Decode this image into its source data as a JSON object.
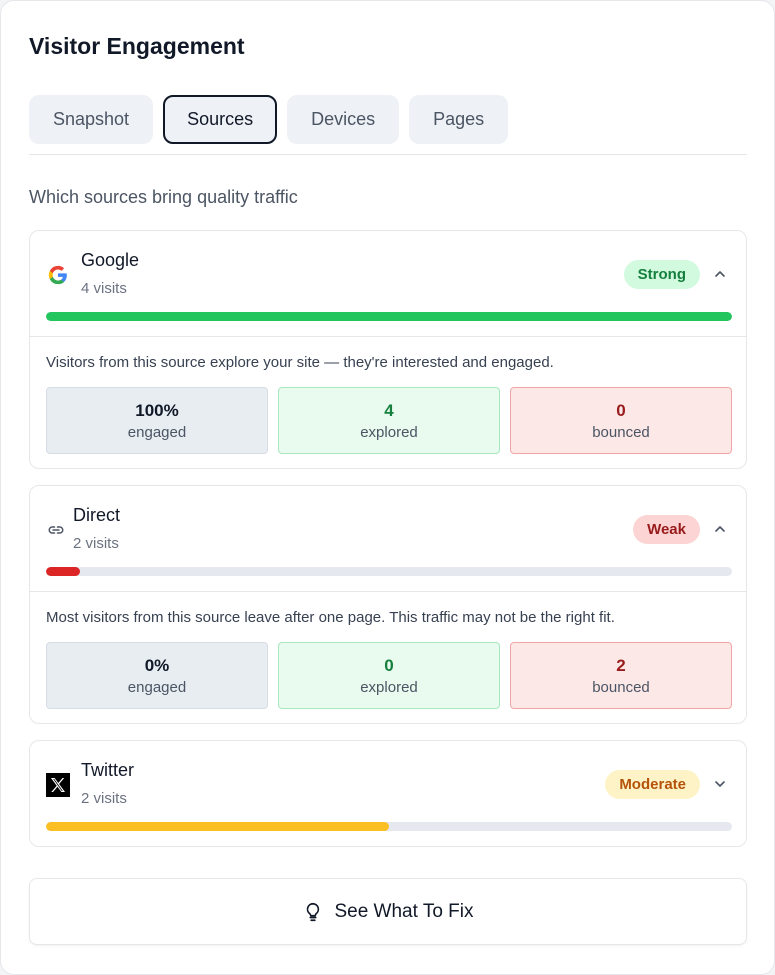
{
  "page": {
    "title": "Visitor Engagement",
    "subtitle": "Which sources bring quality traffic"
  },
  "tabs": [
    {
      "label": "Snapshot",
      "active": false
    },
    {
      "label": "Sources",
      "active": true
    },
    {
      "label": "Devices",
      "active": false
    },
    {
      "label": "Pages",
      "active": false
    }
  ],
  "sources": [
    {
      "name": "Google",
      "visits": "4 visits",
      "badge": "Strong",
      "icon": "google-icon",
      "bar_fraction": 1.0,
      "expanded": true,
      "description": "Visitors from this source explore your site — they're interested and engaged.",
      "stats": {
        "engaged": "100%",
        "engaged_label": "engaged",
        "explored": "4",
        "explored_label": "explored",
        "bounced": "0",
        "bounced_label": "bounced"
      }
    },
    {
      "name": "Direct",
      "visits": "2 visits",
      "badge": "Weak",
      "icon": "link-icon",
      "bar_fraction": 0.05,
      "expanded": true,
      "description": "Most visitors from this source leave after one page. This traffic may not be the right fit.",
      "stats": {
        "engaged": "0%",
        "engaged_label": "engaged",
        "explored": "0",
        "explored_label": "explored",
        "bounced": "2",
        "bounced_label": "bounced"
      }
    },
    {
      "name": "Twitter",
      "visits": "2 visits",
      "badge": "Moderate",
      "icon": "x-logo-icon",
      "bar_fraction": 0.5,
      "expanded": false
    }
  ],
  "colors": {
    "strong_bar": "#22c55e",
    "weak_bar": "#dc2626",
    "moderate_bar": "#fbbf24",
    "strong_badge_bg": "#d1fadf",
    "strong_badge_text": "#15803d",
    "weak_badge_bg": "#fcd4d4",
    "weak_badge_text": "#991b1b",
    "moderate_badge_bg": "#fef3c7",
    "moderate_badge_text": "#b45309"
  },
  "fix_button": {
    "label": "See What To Fix",
    "icon": "lightbulb-icon"
  }
}
